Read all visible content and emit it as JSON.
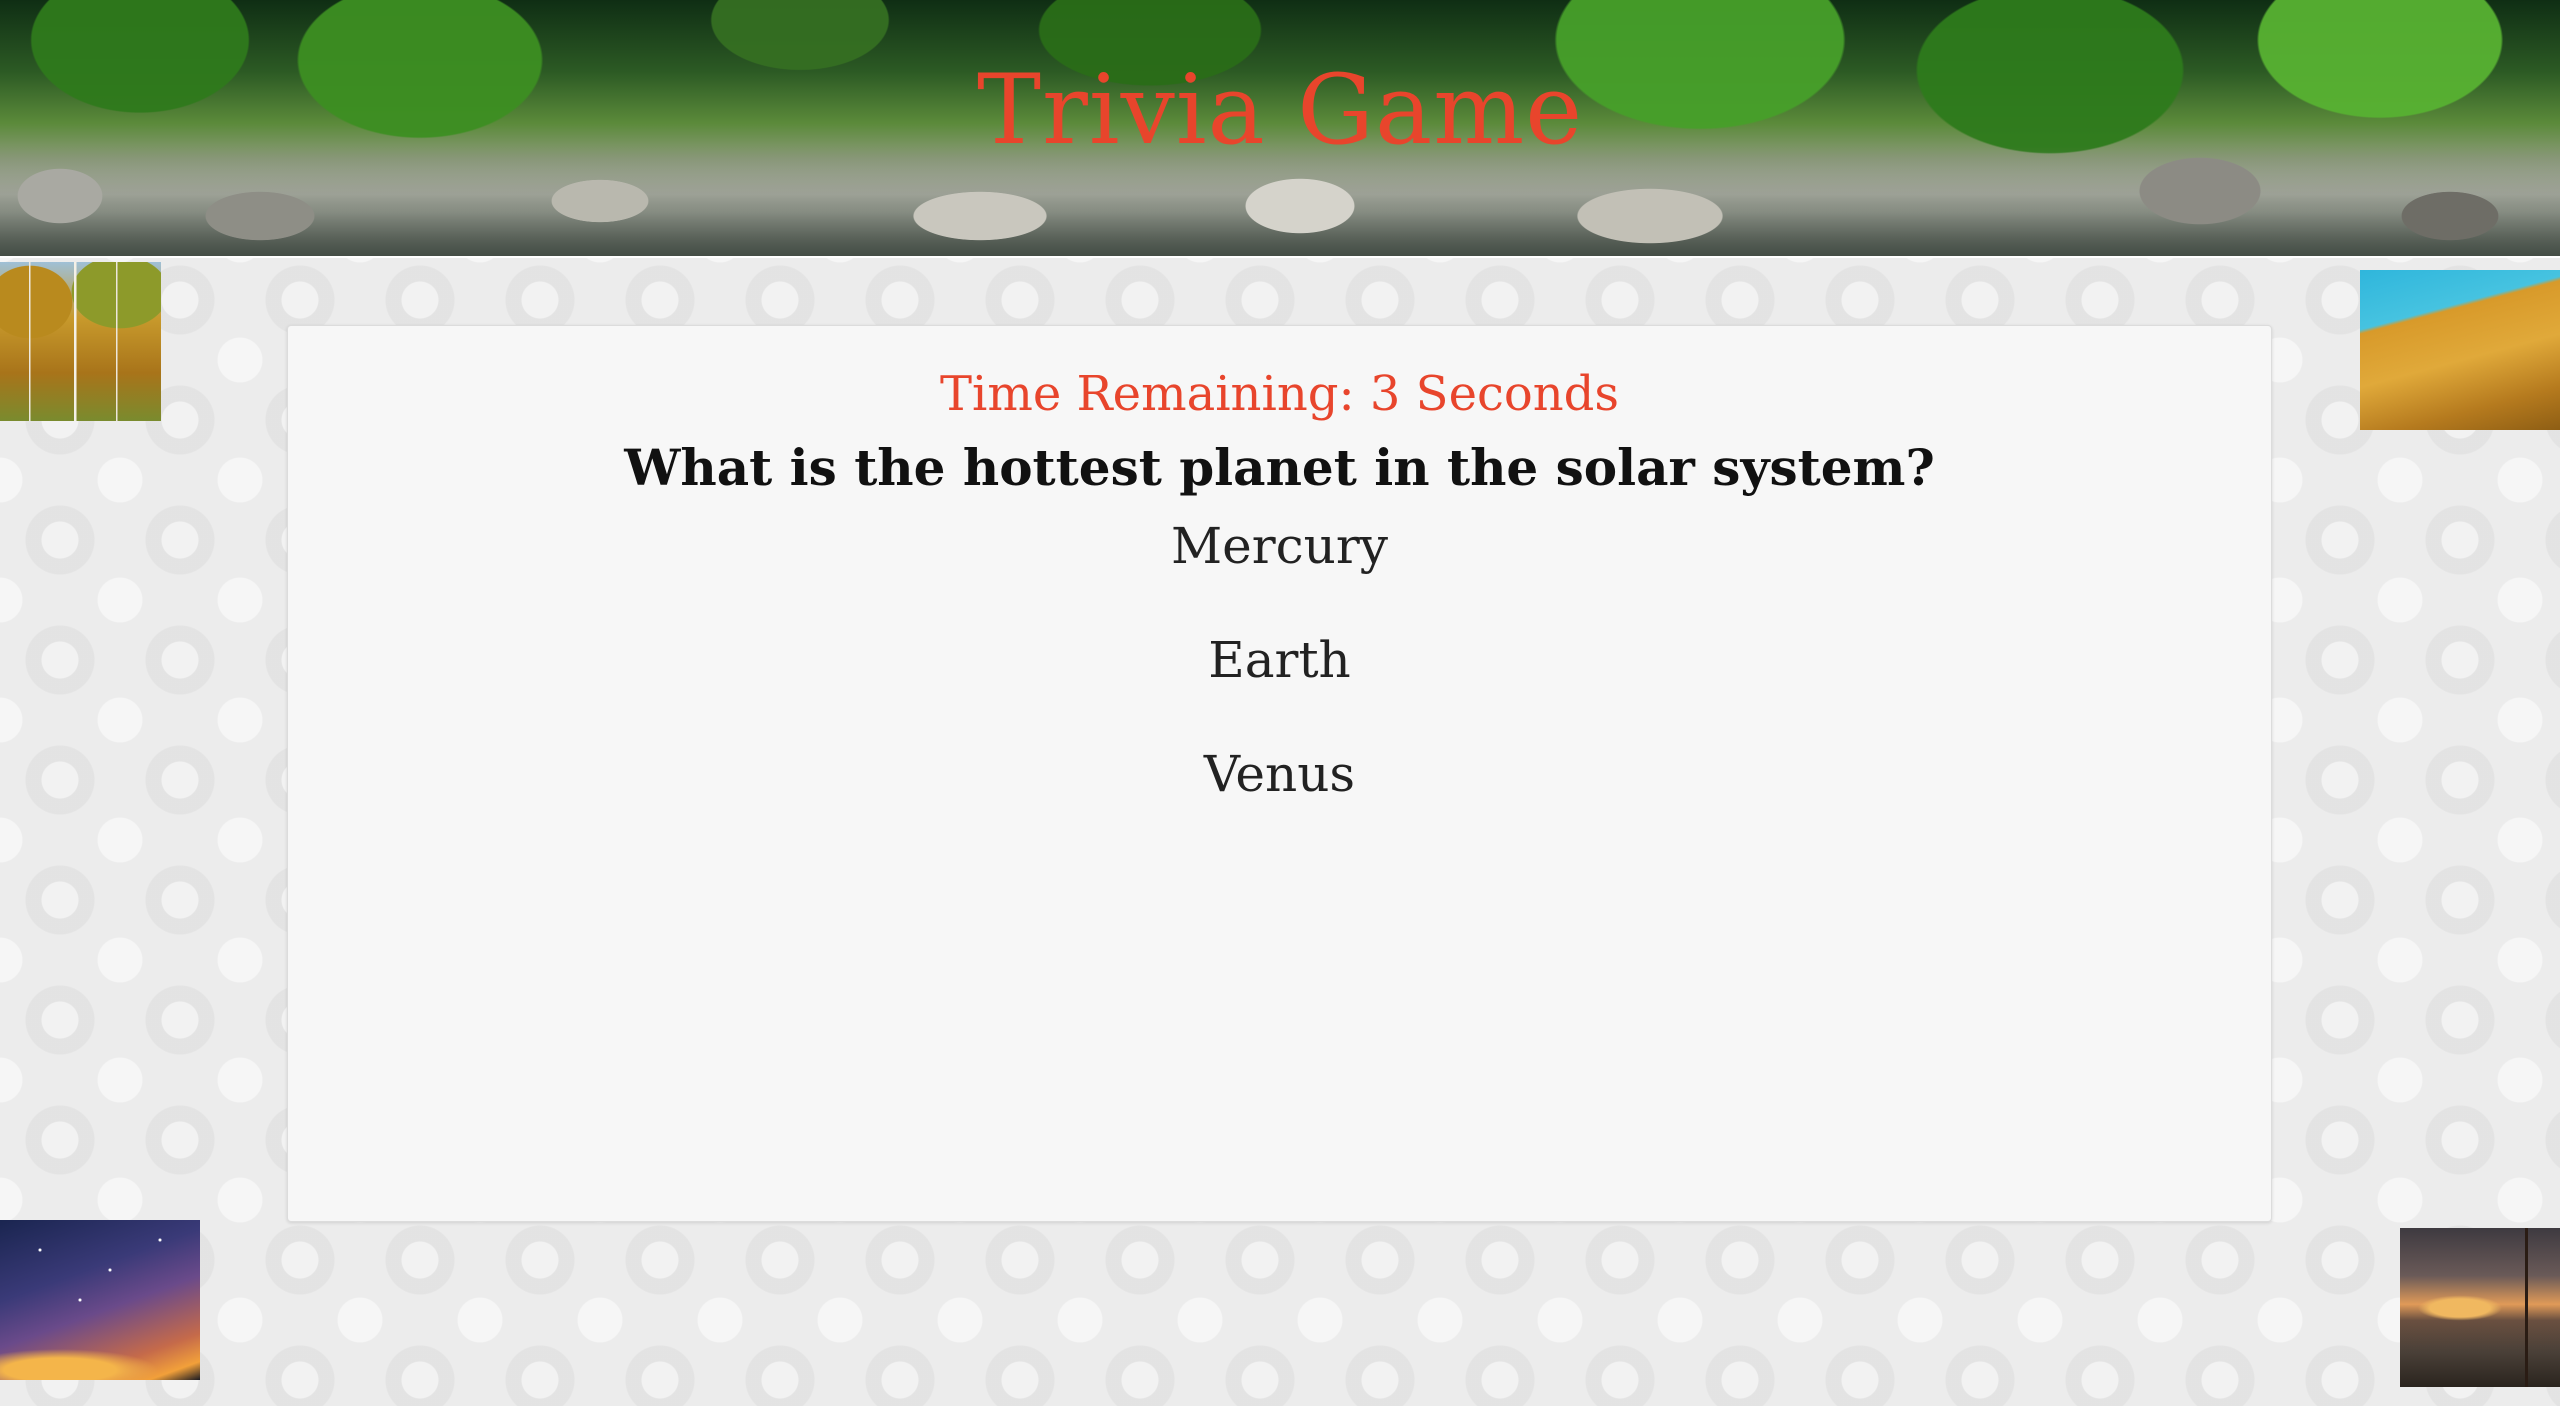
{
  "header": {
    "title": "Trivia Game"
  },
  "quiz": {
    "timer_text": "Time Remaining: 3 Seconds",
    "question": "What is the hottest planet in the solar system?",
    "answers": [
      "Mercury",
      "Earth",
      "Venus"
    ]
  },
  "colors": {
    "accent": "#e8452c",
    "panel_background": "#f7f7f7",
    "question_text": "#111111"
  },
  "images": {
    "banner": "river-forest-banner",
    "top_left": "autumn-forest-photo",
    "top_right": "golden-field-photo",
    "bottom_left": "milky-way-photo",
    "bottom_right": "lake-sunset-photo"
  }
}
